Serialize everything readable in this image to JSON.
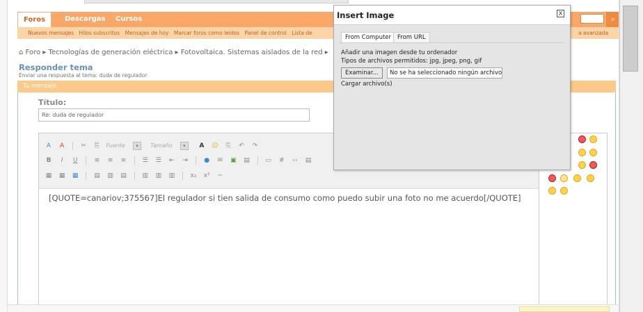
{
  "nav": {
    "tabs": [
      {
        "label": "Foros"
      },
      {
        "label": "Descargas"
      },
      {
        "label": "Cursos"
      }
    ],
    "subnav": [
      "Nuevos mensajes",
      "Hilos subscritos",
      "Mensajes de hoy",
      "Marcar foros como leídos",
      "Panel de control",
      "Lista de"
    ],
    "subnav_right": "a avanzada"
  },
  "breadcrumb": "Foro  ▸  Tecnologías de generación eléctrica  ▸  Fotovoltaica. Sistemas aislados de la red  ▸",
  "reply": {
    "title": "Responder tema",
    "subtitle": "Enviar una respuesta al tema: duda de regulador"
  },
  "message": {
    "header": "Tu mensaje",
    "title_label": "Título:",
    "title_value": "Re: duda de regulador",
    "font_select": "Fuente",
    "size_select": "Tamaño",
    "editor_text": "[QUOTE=canariov;375567]El regulador si tien salida de consumo como puedo subir una foto no me acuerdo[/QUOTE]"
  },
  "modal": {
    "title": "Insert Image",
    "close": "X",
    "tabs": [
      {
        "label": "From Computer"
      },
      {
        "label": "From URL"
      }
    ],
    "line1": "Añadir una imagen desde tu ordenador",
    "line2": "Tipos de archivos permitidos: jpg, jpeg, png, gif",
    "browse_button": "Examinar...",
    "file_status": "No se ha seleccionado ningún archivo.",
    "upload_link": "Cargar archivo(s)"
  },
  "colors": {
    "nav_orange": "#f9a869",
    "accent_orange": "#f08a3c",
    "msg_header": "#fbc98a",
    "title_blue": "#6b8fb5"
  }
}
